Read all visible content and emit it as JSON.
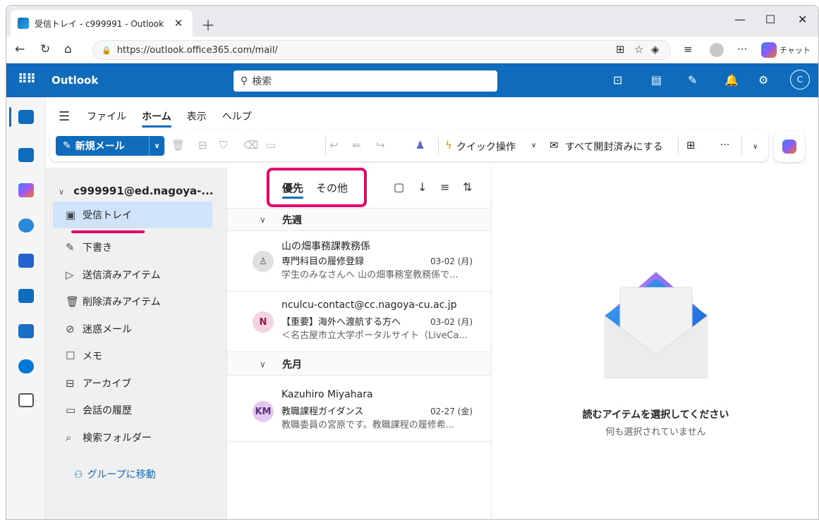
{
  "browser": {
    "tab_title": "受信トレイ - c999991 - Outlook",
    "url": "https://outlook.office365.com/mail/",
    "chat_label": "チャット"
  },
  "app": {
    "name": "Outlook",
    "search_placeholder": "検索",
    "account_initial": "C",
    "accent": "#0f6cbd",
    "highlight": "#e3006b"
  },
  "menu": {
    "items": [
      "ファイル",
      "ホーム",
      "表示",
      "ヘルプ"
    ],
    "active": "ホーム"
  },
  "ribbon": {
    "new_mail": "新規メール",
    "quick_actions": "クイック操作",
    "mark_all_read": "すべて開封済みにする",
    "more": "···"
  },
  "folders": {
    "account": "c999991@ed.nagoya-...",
    "items": [
      {
        "icon": "inbox-icon",
        "glyph": "▣",
        "label": "受信トレイ"
      },
      {
        "icon": "drafts-icon",
        "glyph": "✎",
        "label": "下書き"
      },
      {
        "icon": "sent-icon",
        "glyph": "▷",
        "label": "送信済みアイテム"
      },
      {
        "icon": "trash-icon",
        "glyph": "🗑",
        "label": "削除済みアイテム"
      },
      {
        "icon": "junk-icon",
        "glyph": "⊘",
        "label": "迷惑メール"
      },
      {
        "icon": "note-icon",
        "glyph": "☐",
        "label": "メモ"
      },
      {
        "icon": "archive-icon",
        "glyph": "⊟",
        "label": "アーカイブ"
      },
      {
        "icon": "folder-icon",
        "glyph": "▭",
        "label": "会話の履歴"
      },
      {
        "icon": "search-folder-icon",
        "glyph": "⌕",
        "label": "検索フォルダー"
      }
    ],
    "group_link": "グループに移動"
  },
  "list": {
    "tabs": [
      "優先",
      "その他"
    ],
    "groups": [
      {
        "label": "先週",
        "messages": [
          {
            "avatar": "",
            "avatar_color": "#e0e0e0",
            "sender": "山の畑事務課教務係",
            "subject": "専門科目の履修登録",
            "date": "03-02 (月)",
            "preview": "学生のみなさんへ 山の畑事務室教務係で..."
          },
          {
            "avatar": "N",
            "avatar_color": "#f4d3e3",
            "sender": "nculcu-contact@cc.nagoya-cu.ac.jp",
            "subject": "【重要】海外へ渡航する方へ",
            "date": "03-02 (月)",
            "preview": "＜名古屋市立大学ポータルサイト（LiveCa..."
          }
        ]
      },
      {
        "label": "先月",
        "messages": [
          {
            "avatar": "KM",
            "avatar_color": "#e3c8ef",
            "sender": "Kazuhiro Miyahara",
            "subject": "教職課程ガイダンス",
            "date": "02-27 (金)",
            "preview": "教職委員の宮原です。教職課程の履修希..."
          }
        ]
      }
    ]
  },
  "reading": {
    "title": "読むアイテムを選択してください",
    "subtitle": "何も選択されていません"
  }
}
